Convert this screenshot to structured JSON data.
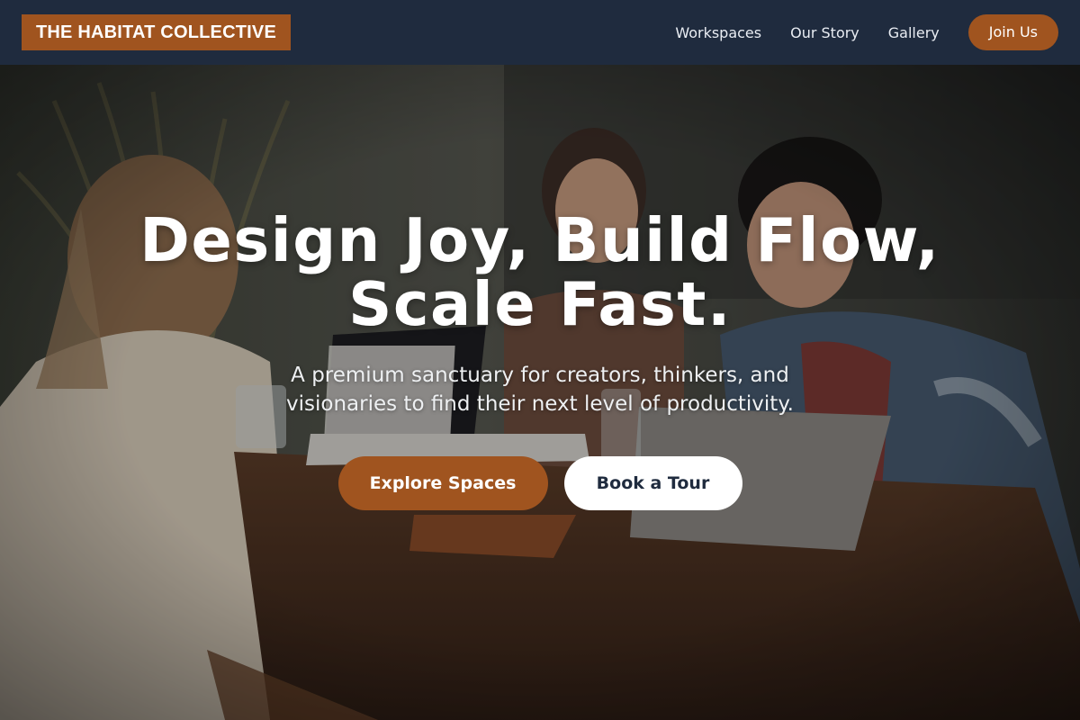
{
  "brand": {
    "name": "THE HABITAT COLLECTIVE"
  },
  "nav": {
    "links": [
      "Workspaces",
      "Our Story",
      "Gallery"
    ],
    "cta_label": "Join Us"
  },
  "hero": {
    "headline_line1": "Design Joy, Build Flow,",
    "headline_line2": "Scale Fast.",
    "subheadline": "A premium sanctuary for creators, thinkers, and visionaries to find their next level of productivity.",
    "primary_button": "Explore Spaces",
    "secondary_button": "Book a Tour",
    "background_image": "photo of three people meeting at a wooden table with laptops in a coworking cafe"
  },
  "colors": {
    "navbar_bg": "#1f2b3e",
    "accent": "#a0541f",
    "white": "#ffffff"
  }
}
